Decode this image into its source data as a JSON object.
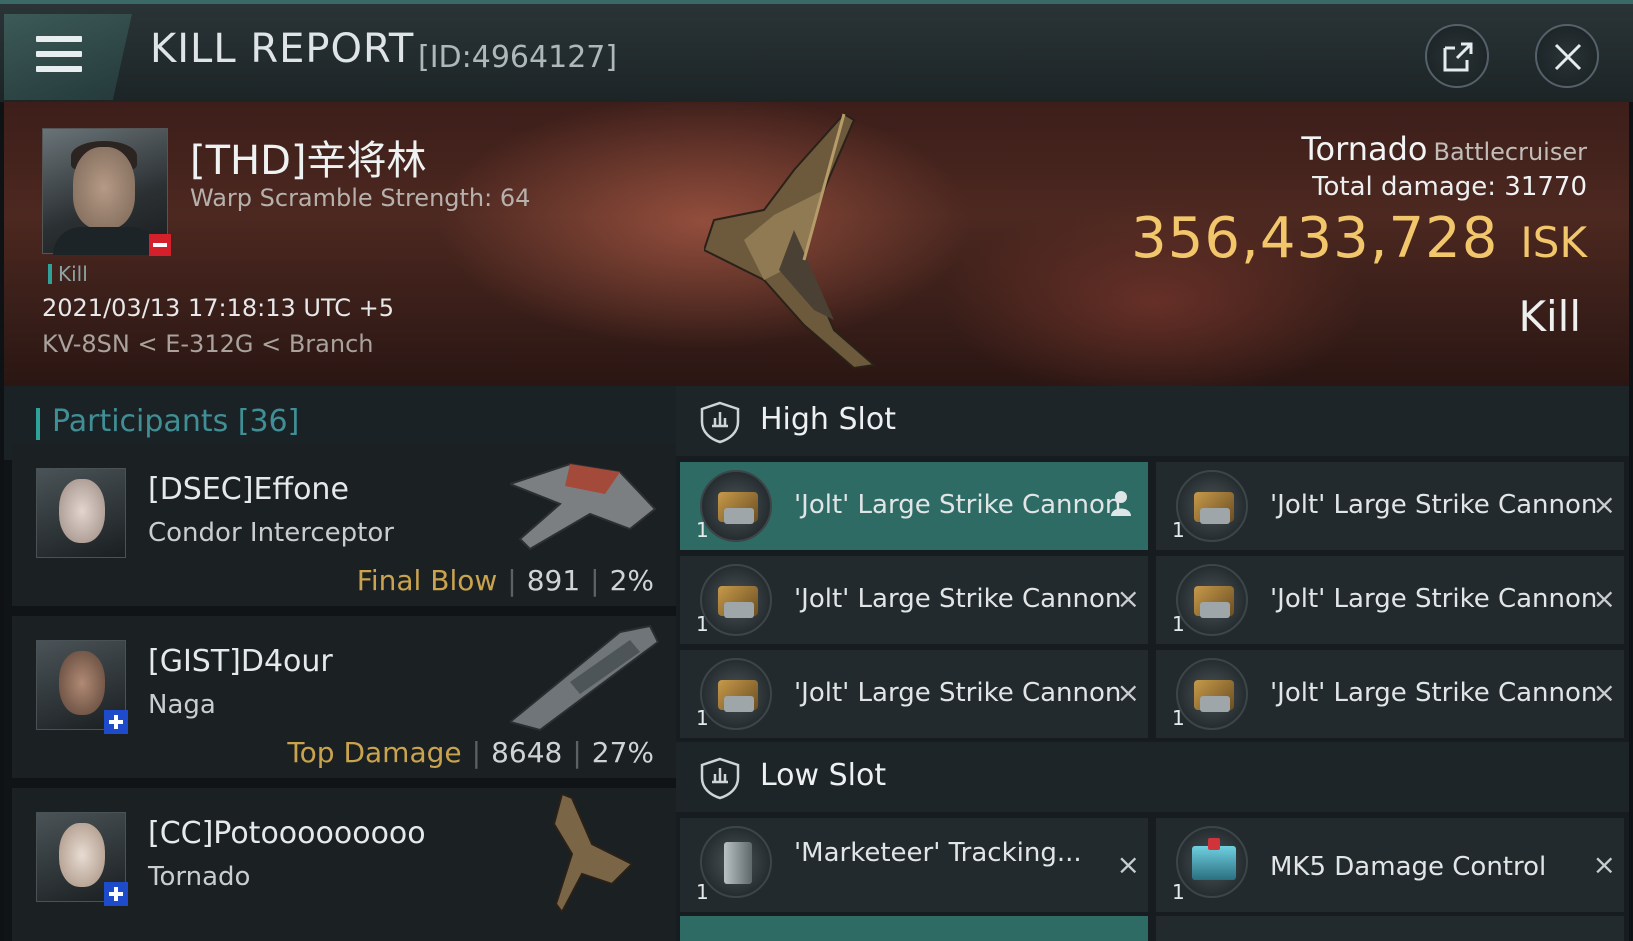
{
  "header": {
    "title": "KILL REPORT",
    "report_id": "[ID:4964127]"
  },
  "victim": {
    "name": "[THD]辛将林",
    "warp_scramble": "Warp Scramble Strength: 64",
    "tag": "Kill",
    "timestamp": "2021/03/13 17:18:13 UTC +5",
    "location": "KV-8SN < E-312G < Branch",
    "ship_name": "Tornado",
    "ship_class": "Battlecruiser",
    "total_damage_label": "Total damage:",
    "total_damage": "31770",
    "isk_value": "356,433,728",
    "isk_unit": "ISK",
    "result": "Kill"
  },
  "participants": {
    "label": "Participants [36]",
    "rows": [
      {
        "name": "[DSEC]Effone",
        "ship": "Condor Interceptor",
        "tag": "Final Blow",
        "damage": "891",
        "percent": "2%"
      },
      {
        "name": "[GIST]D4our",
        "ship": "Naga",
        "tag": "Top Damage",
        "damage": "8648",
        "percent": "27%"
      },
      {
        "name": "[CC]Potooooooooo",
        "ship": "Tornado"
      }
    ]
  },
  "fitting": {
    "high_slot_label": "High Slot",
    "low_slot_label": "Low Slot",
    "high_slots": [
      {
        "name": "'Jolt' Large Strike Cannon",
        "qty": "1",
        "status": "dropped"
      },
      {
        "name": "'Jolt' Large Strike Cannon",
        "qty": "1",
        "status": "destroyed"
      },
      {
        "name": "'Jolt' Large Strike Cannon",
        "qty": "1",
        "status": "destroyed"
      },
      {
        "name": "'Jolt' Large Strike Cannon",
        "qty": "1",
        "status": "destroyed"
      },
      {
        "name": "'Jolt' Large Strike Cannon",
        "qty": "1",
        "status": "destroyed"
      },
      {
        "name": "'Jolt' Large Strike Cannon",
        "qty": "1",
        "status": "destroyed"
      }
    ],
    "low_slots": [
      {
        "name": "'Marketeer' Tracking...",
        "qty": "1",
        "status": "destroyed"
      },
      {
        "name": "MK5 Damage Control",
        "qty": "1",
        "status": "destroyed"
      }
    ],
    "destroyed_glyph": "×"
  },
  "colors": {
    "accent_teal": "#2fa39a",
    "isk_gold": "#f2c66b",
    "tag_gold": "#c9a34d",
    "selected_module": "#2e6b65"
  },
  "icons": {
    "menu": "hamburger-icon",
    "share": "external-link-icon",
    "close": "close-icon",
    "slot": "shield-slot-icon",
    "dropped": "person-icon"
  }
}
